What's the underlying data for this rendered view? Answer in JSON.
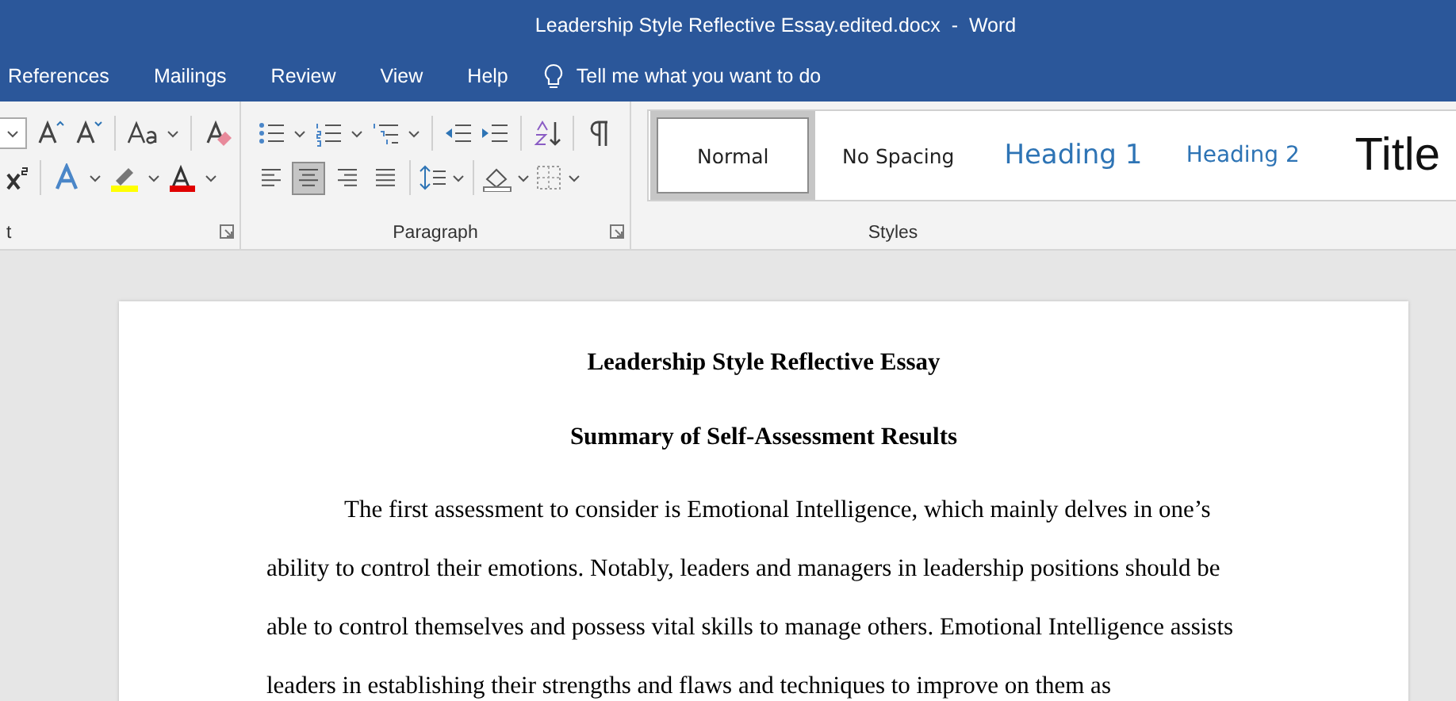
{
  "window": {
    "title": "Leadership Style Reflective Essay.edited.docx  -  Word"
  },
  "tabs": [
    {
      "label": "References",
      "selected": false
    },
    {
      "label": "Mailings",
      "selected": false
    },
    {
      "label": "Review",
      "selected": false
    },
    {
      "label": "View",
      "selected": false
    },
    {
      "label": "Help",
      "selected": false
    }
  ],
  "tell_me": {
    "placeholder": "Tell me what you want to do"
  },
  "ribbon": {
    "font_group": {
      "label": "t"
    },
    "paragraph_group": {
      "label": "Paragraph",
      "alignment": [
        {
          "kind": "left",
          "selected": false
        },
        {
          "kind": "center",
          "selected": true
        },
        {
          "kind": "right",
          "selected": false
        },
        {
          "kind": "justify",
          "selected": false
        }
      ]
    },
    "styles_group": {
      "label": "Styles",
      "styles": [
        {
          "name": "Normal",
          "kind": "normal",
          "selected": true
        },
        {
          "name": "No Spacing",
          "kind": "normal",
          "selected": false
        },
        {
          "name": "Heading 1",
          "kind": "heading1",
          "selected": false
        },
        {
          "name": "Heading 2",
          "kind": "heading2",
          "selected": false
        },
        {
          "name": "Title",
          "kind": "title",
          "selected": false
        }
      ]
    }
  },
  "document": {
    "title": "Leadership Style Reflective Essay",
    "heading": "Summary of Self-Assessment Results",
    "paragraph": "The first assessment to consider is Emotional Intelligence, which mainly delves in one’s ability to control their emotions. Notably, leaders and managers in leadership positions should be able to control themselves and possess vital skills to manage others. Emotional Intelligence assists leaders in establishing their strengths and flaws and techniques to improve on them as"
  }
}
